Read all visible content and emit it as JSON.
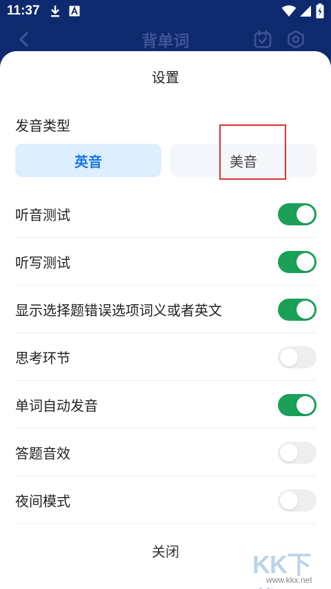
{
  "status_bar": {
    "time": "11:37",
    "left_icons": [
      "download-icon",
      "a-app-icon"
    ],
    "right_icons": [
      "wifi-icon",
      "signal-icon",
      "battery-charging-icon"
    ]
  },
  "app_bar": {
    "title": "背单词",
    "icons": [
      "back-chevron-icon",
      "calendar-check-icon",
      "settings-hex-icon"
    ]
  },
  "sheet": {
    "title": "设置",
    "pronunciation": {
      "label": "发音类型",
      "options": [
        "英音",
        "美音"
      ],
      "selected": "英音"
    },
    "settings": [
      {
        "label": "听音测试",
        "on": true
      },
      {
        "label": "听写测试",
        "on": true
      },
      {
        "label": "显示选择题错误选项词义或者英文",
        "on": true
      },
      {
        "label": "思考环节",
        "on": false
      },
      {
        "label": "单词自动发音",
        "on": true
      },
      {
        "label": "答题音效",
        "on": false
      },
      {
        "label": "夜间模式",
        "on": false
      }
    ],
    "close_label": "关闭"
  },
  "watermark": {
    "brand": "KK下载",
    "url": "www.kkx.net"
  },
  "colors": {
    "header_bg": "#0d2a6e",
    "accent_blue": "#1677e6",
    "toggle_on": "#1ba05a",
    "toggle_off": "#eeeeee",
    "highlight": "#e0302c"
  }
}
